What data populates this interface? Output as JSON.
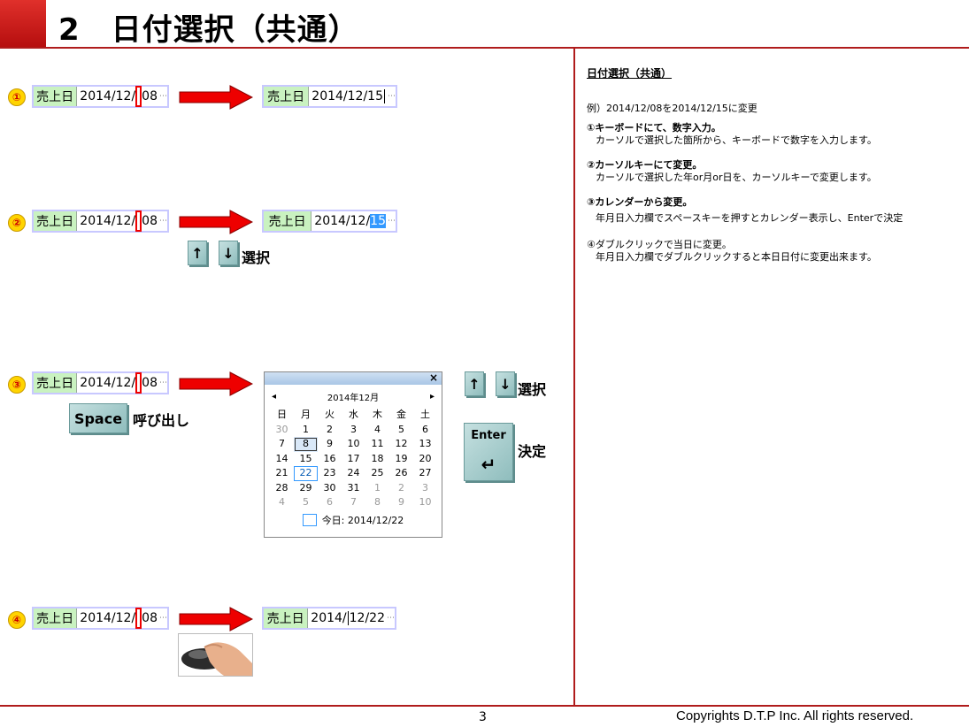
{
  "header": {
    "title": "2　日付選択（共通）"
  },
  "rows": [
    {
      "num": "①",
      "label": "売上日",
      "before_a": "2014/12/",
      "before_b": "08",
      "after": "2014/12/15"
    },
    {
      "num": "②",
      "label": "売上日",
      "before_a": "2014/12/",
      "before_b": "08",
      "after_a": "2014/12/",
      "after_b": "15"
    },
    {
      "num": "③",
      "label": "売上日",
      "before_a": "2014/12/",
      "before_b": "08"
    },
    {
      "num": "④",
      "label": "売上日",
      "before_a": "2014/12/",
      "before_b": "08",
      "after_a": "2014/",
      "after_b": "12/22"
    }
  ],
  "keys": {
    "up": "↑",
    "down": "↓",
    "select_label": "選択",
    "space": "Space",
    "call_label": "呼び出し",
    "enter": "Enter",
    "enter_symbol": "↵",
    "decide_label": "決定"
  },
  "calendar": {
    "month": "2014年12月",
    "prev": "◂",
    "next": "▸",
    "close": "×",
    "weekdays": [
      "日",
      "月",
      "火",
      "水",
      "木",
      "金",
      "土"
    ],
    "days": [
      "30",
      "1",
      "2",
      "3",
      "4",
      "5",
      "6",
      "7",
      "8",
      "9",
      "10",
      "11",
      "12",
      "13",
      "14",
      "15",
      "16",
      "17",
      "18",
      "19",
      "20",
      "21",
      "22",
      "23",
      "24",
      "25",
      "26",
      "27",
      "28",
      "29",
      "30",
      "31",
      "1",
      "2",
      "3",
      "4",
      "5",
      "6",
      "7",
      "8",
      "9",
      "10"
    ],
    "today": "今日: 2014/12/22"
  },
  "panel": {
    "title": "日付選択（共通）",
    "example": "例）2014/12/08を2014/12/15に変更",
    "s1_title": "①キーボードにて、数字入力。",
    "s1_body": "カーソルで選択した箇所から、キーボードで数字を入力します。",
    "s2_title": "②カーソルキーにて変更。",
    "s2_body": "カーソルで選択した年or月or日を、カーソルキーで変更します。",
    "s3_title": "③カレンダーから変更。",
    "s3_body": "年月日入力欄でスペースキーを押すとカレンダー表示し、Enterで決定",
    "s4_title": "④ダブルクリックで当日に変更。",
    "s4_body": "年月日入力欄でダブルクリックすると本日日付に変更出来ます。"
  },
  "footer": {
    "page": "3",
    "copyright": "Copyrights  D.T.P Inc. All rights reserved."
  }
}
